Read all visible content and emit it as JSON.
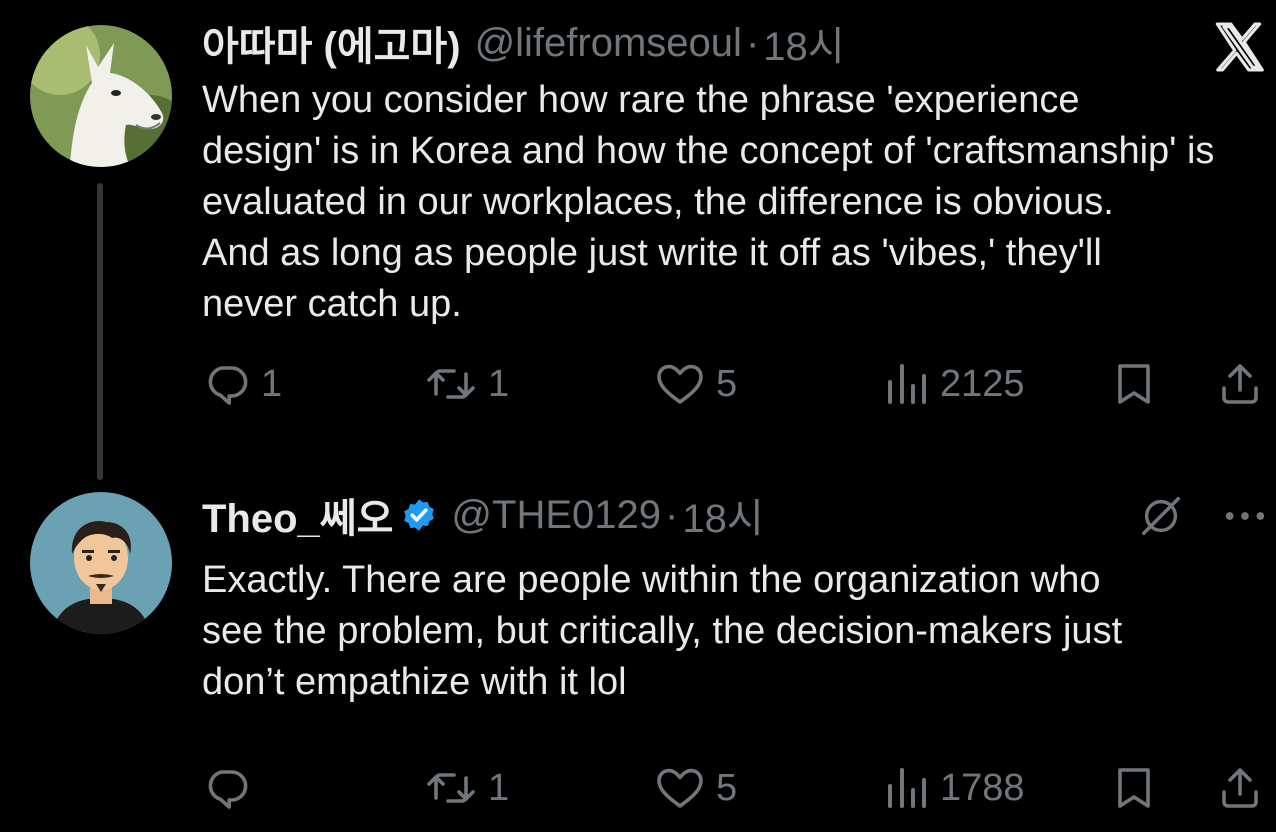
{
  "tweets": [
    {
      "display_name": "아따마 (에고마)",
      "handle": "@lifefromseoul",
      "separator": "·",
      "time": "18시",
      "text_lines": [
        "When you consider how rare the phrase 'experience",
        "design' is in Korea and how the concept of 'craftsmanship' is",
        "evaluated in our workplaces, the difference is obvious.",
        "And as long as people just write it off as 'vibes,' they'll",
        "never catch up."
      ],
      "replies": "1",
      "reposts": "1",
      "likes": "5",
      "views": "2125"
    },
    {
      "display_name": "Theo_쎄오",
      "handle": "@THE0129",
      "separator": "·",
      "time": "18시",
      "text_lines": [
        "Exactly. There are people within the organization who",
        "see the problem, but critically, the decision-makers just",
        "don’t empathize with it lol"
      ],
      "replies": "",
      "reposts": "1",
      "likes": "5",
      "views": "1788"
    }
  ],
  "icons": {
    "brand": "x-logo-icon",
    "reply": "reply-icon",
    "repost": "repost-icon",
    "like": "heart-icon",
    "views": "views-icon",
    "bookmark": "bookmark-icon",
    "share": "share-icon",
    "verified": "verified-badge-icon",
    "grok": "grok-icon",
    "more": "more-icon"
  },
  "colors": {
    "background": "#000000",
    "text": "#e7e9ea",
    "secondary": "#71767b",
    "verified": "#1d9bf0"
  }
}
